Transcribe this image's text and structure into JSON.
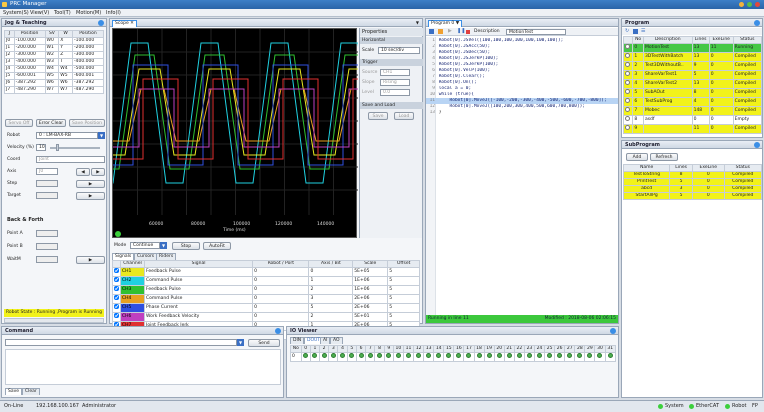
{
  "app": {
    "title": "PRC Manager",
    "menus": [
      "System(S)",
      "View(V)",
      "Tool(T)",
      "Motion(M)",
      "Info(I)"
    ]
  },
  "jog": {
    "title": "Jog & Teaching",
    "headers": [
      "J",
      "Position",
      "SV",
      "W",
      "Position"
    ],
    "rows": [
      [
        "J0",
        "-100.000",
        "W0",
        "X",
        "-100.000"
      ],
      [
        "J1",
        "-200.000",
        "W1",
        "Y",
        "-200.000"
      ],
      [
        "J2",
        "-300.000",
        "W2",
        "Z",
        "-300.000"
      ],
      [
        "J3",
        "-400.000",
        "W3",
        "T",
        "-400.000"
      ],
      [
        "J4",
        "-500.000",
        "W4",
        "W4",
        "-500.000"
      ],
      [
        "J5",
        "-600.001",
        "W5",
        "W5",
        "-600.001"
      ],
      [
        "J6",
        "-387.292",
        "W6",
        "W6",
        "-387.292"
      ],
      [
        "J7",
        "-487.290",
        "W7",
        "W7",
        "-487.290"
      ]
    ],
    "btn_servo_off": "Servo Off",
    "btn_error_clear": "Error Clear",
    "btn_save_position": "Save Position",
    "robot_label": "Robot",
    "robot_value": "0 : LM-BAX-RB",
    "velocity_label": "Velocity (%)",
    "velocity_value": "10",
    "coord_label": "Coord",
    "coord_value": "Joint",
    "axis_label": "Axis",
    "axis_value": "J0",
    "step_label": "Step",
    "target_label": "Target",
    "back_forth": "Back & Forth",
    "point_a": "Point A",
    "point_b": "Point B",
    "waitm": "WaitM",
    "status": "Robot State : Running ,Program is Running"
  },
  "scope": {
    "tab": "Scope",
    "xlabel": "Time (ms)",
    "ticks": [
      "60000",
      "80000",
      "100000",
      "120000",
      "140000"
    ],
    "mode_label": "Mode",
    "mode_value": "Continue",
    "btn_stop": "Stop",
    "btn_autofit": "AutoFit",
    "tabs": [
      "Signals",
      "Cursors",
      "Riders"
    ],
    "sig_headers": [
      "",
      "Channel",
      "Signal",
      "Robot / Port",
      "Axis / Bit",
      "Scale",
      "Offset"
    ],
    "signals": [
      [
        "CH1",
        "Feedback Pulse",
        "0",
        "0",
        "5E+05",
        "5",
        "#e8e820"
      ],
      [
        "CH2",
        "Command Pulse",
        "0",
        "1",
        "1E+06",
        "5",
        "#20d0e0"
      ],
      [
        "CH3",
        "Feedback Pulse",
        "0",
        "2",
        "1E+06",
        "5",
        "#30c030"
      ],
      [
        "CH4",
        "Command Pulse",
        "0",
        "3",
        "2E+06",
        "5",
        "#e8a020"
      ],
      [
        "CH5",
        "Phase Current",
        "0",
        "5",
        "2E+06",
        "5",
        "#3050e0"
      ],
      [
        "CH6",
        "Work Feedback Velocity",
        "0",
        "2",
        "5E+01",
        "5",
        "#c040c0"
      ],
      [
        "CH7",
        "Joint Feedback Jerk",
        "0",
        "1",
        "2E+06",
        "5",
        "#e03030"
      ],
      [
        "CH8",
        "Disable",
        "",
        "",
        "",
        "",
        "#20a020"
      ]
    ],
    "colors": [
      "#e8e820",
      "#20d0e0",
      "#30c030",
      "#e8a020",
      "#3050e0",
      "#c040c0",
      "#e03030"
    ]
  },
  "props": {
    "title": "Properties",
    "horizontal": "Horizontal",
    "scale_label": "Scale",
    "scale_value": "10 sec/div",
    "trigger": "Trigger",
    "source_label": "Source",
    "source_value": "CH1",
    "slope_label": "Slope",
    "slope_value": "Rising",
    "level_label": "Level",
    "level_value": "0.0",
    "save_load": "Save and Load",
    "btn_save": "Save",
    "btn_load": "Load"
  },
  "prog_editor": {
    "tab": "Program 0",
    "desc_label": "Description",
    "desc_value": "MotionTest",
    "lines": [
      "Robot[0].JSVel([100,100,100,100,100,100,100]);",
      "Robot[0].JSAcc(50);",
      "Robot[0].JSDec(50);",
      "Robot[0].JSJerkP(100);",
      "Robot[0].JSJerkP(100);",
      "Robot[0].VelP(100);",
      "Robot[0].Clear();",
      "Robot[0].On();",
      "local a = 0;",
      "while (true){",
      "    Robot[0].MoveJ([-100,-200,-300,-400,-500,-600,-700,-800]);",
      "    Robot[0].MoveJ([100,200,300,400,500,600,700,800]);",
      "}"
    ],
    "status_left": "Running in line 11",
    "status_right": "Modified : 2018-08-06 02:06:15"
  },
  "program": {
    "title": "Program",
    "headers": [
      "",
      "No",
      "Description",
      "Lines",
      "ExeLine",
      "Status"
    ],
    "rows": [
      [
        "0",
        "MotionTest",
        "13",
        "11",
        "Running"
      ],
      [
        "1",
        "3DTestWithBatch",
        "13",
        "0",
        "Compiled"
      ],
      [
        "2",
        "Test3DWithoutB..",
        "9",
        "0",
        "Compiled"
      ],
      [
        "3",
        "ShareVarTest1",
        "5",
        "0",
        "Compiled"
      ],
      [
        "4",
        "ShareVarTest2",
        "13",
        "0",
        "Compiled"
      ],
      [
        "5",
        "SubAOut",
        "8",
        "0",
        "Compiled"
      ],
      [
        "6",
        "TestSubProg",
        "4",
        "0",
        "Compiled"
      ],
      [
        "7",
        "Mobec",
        "148",
        "0",
        "Compiled"
      ],
      [
        "8",
        "asdf",
        "0",
        "0",
        "Empty"
      ],
      [
        "9",
        "",
        "11",
        "0",
        "Compiled"
      ]
    ]
  },
  "subprogram": {
    "title": "SubProgram",
    "btn_add": "Add",
    "btn_refresh": "Refresh",
    "headers": [
      "Name",
      "Lines",
      "ExeLine",
      "Status"
    ],
    "rows": [
      [
        "TestToString",
        "8",
        "0",
        "Compiled"
      ],
      [
        "PrintTest",
        "5",
        "0",
        "Compiled"
      ],
      [
        "abcd",
        "3",
        "0",
        "Compiled"
      ],
      [
        "StartAllPg",
        "5",
        "0",
        "Compiled"
      ]
    ]
  },
  "command": {
    "title": "Command",
    "btn_send": "Send",
    "btn_save": "Save",
    "btn_clear": "Clear"
  },
  "io": {
    "title": "IO Viewer",
    "tabs": [
      "DIN",
      "DOUT",
      "AI",
      "AO"
    ],
    "no_label": "No",
    "port": "0"
  },
  "statusbar": {
    "online": "On-Line",
    "ip": "192.168.100.167",
    "user": "Administrator",
    "system": "System",
    "ethercat": "EtherCAT",
    "robot": "Robot",
    "fps": "FP"
  }
}
